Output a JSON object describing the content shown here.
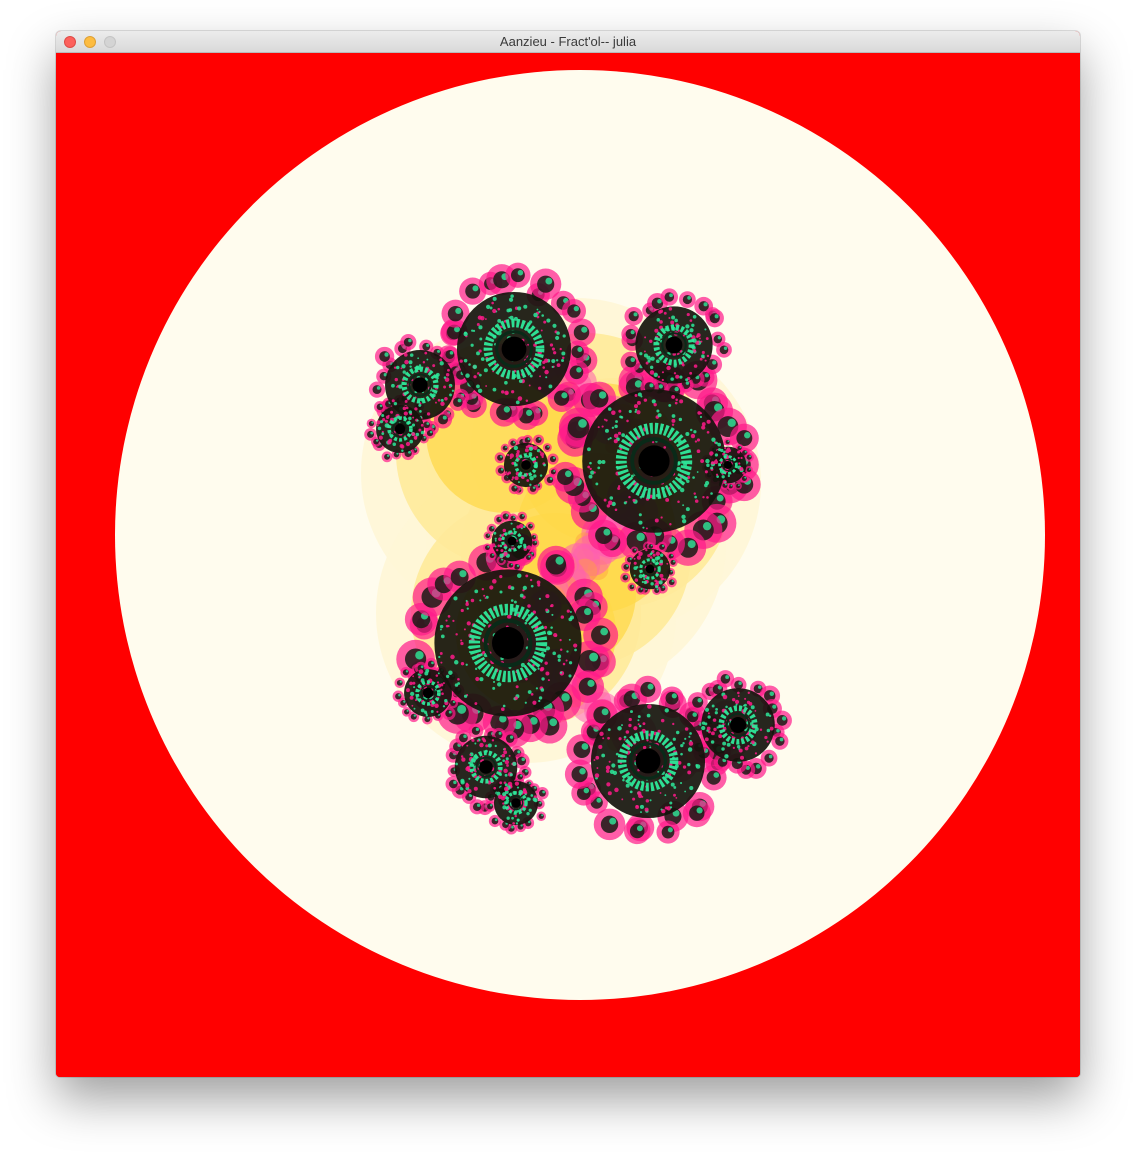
{
  "window": {
    "title": "Aanzieu - Fract'ol-- julia"
  },
  "colors": {
    "background": "#ff0000",
    "halo": "#fffcee",
    "glow_inner": "#ffd84a",
    "glow_mid": "#ffea9a",
    "glow_outer": "#fff6d6",
    "petal_pink": "#ff5fb0",
    "petal_magenta": "#ff1a8a",
    "petal_orange": "#ffa040",
    "spiral_green": "#2ee89a",
    "core_black": "#000000"
  },
  "icons": {
    "close": "traffic-light-close",
    "minimize": "traffic-light-minimize",
    "zoom": "traffic-light-zoom"
  }
}
